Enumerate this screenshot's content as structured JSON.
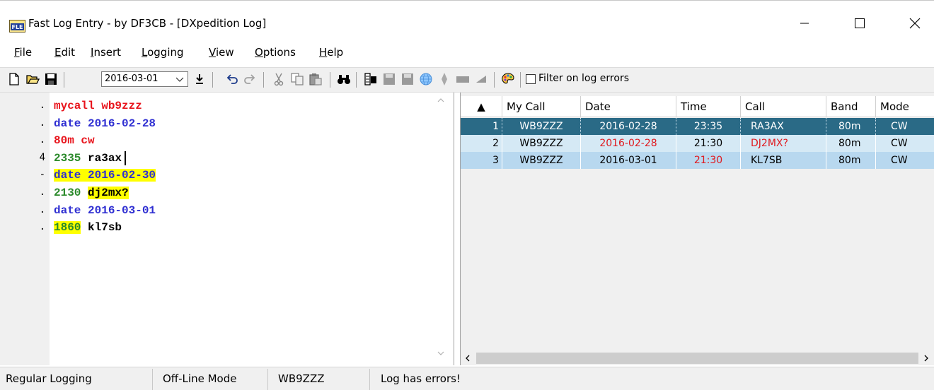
{
  "window": {
    "title": "Fast Log Entry - by DF3CB - [DXpedition Log]",
    "app_icon_text": "FLE",
    "controls": [
      "minimize-icon",
      "maximize-icon",
      "close-icon"
    ]
  },
  "menu": {
    "items": [
      {
        "label": "File",
        "hotkey": "F",
        "rest": "ile"
      },
      {
        "label": "Edit",
        "hotkey": "E",
        "rest": "dit"
      },
      {
        "label": "Insert",
        "hotkey": "I",
        "rest": "nsert"
      },
      {
        "label": "Logging",
        "hotkey": "L",
        "rest": "ogging"
      },
      {
        "label": "View",
        "hotkey": "V",
        "rest": "iew"
      },
      {
        "label": "Options",
        "hotkey": "O",
        "rest": "ptions"
      },
      {
        "label": "Help",
        "hotkey": "H",
        "rest": "elp"
      }
    ]
  },
  "toolbar": {
    "date_value": "2016-03-01",
    "filter_label": "Filter on log errors",
    "filter_checked": false,
    "icons": [
      "new-icon",
      "open-icon",
      "save-icon",
      "download-icon",
      "undo-icon",
      "redo-icon",
      "cut-icon",
      "copy-icon",
      "paste-icon",
      "find-icon",
      "export-icon",
      "upload-icon",
      "upload2-icon",
      "globe-icon",
      "diamond-icon",
      "bar-icon",
      "palette-icon"
    ]
  },
  "editor": {
    "lines": [
      {
        "mark": ".",
        "segments": [
          {
            "t": "mycall wb9zzz",
            "c": "red"
          }
        ]
      },
      {
        "mark": ".",
        "segments": [
          {
            "t": "date 2016-02-28",
            "c": "blue"
          }
        ]
      },
      {
        "mark": ".",
        "segments": [
          {
            "t": "80m cw",
            "c": "red"
          }
        ]
      },
      {
        "mark": "4",
        "segments": [
          {
            "t": "2335",
            "c": "green"
          },
          {
            "t": " ra3ax",
            "c": "black"
          }
        ],
        "caret": true
      },
      {
        "mark": "-",
        "segments": [
          {
            "t": "date 2016-02-30",
            "c": "blue",
            "hl": true
          }
        ]
      },
      {
        "mark": ".",
        "segments": [
          {
            "t": "2130",
            "c": "green"
          },
          {
            "t": " "
          },
          {
            "t": "dj2mx?",
            "c": "black",
            "hl": true
          }
        ]
      },
      {
        "mark": ".",
        "segments": [
          {
            "t": "date 2016-03-01",
            "c": "blue"
          }
        ]
      },
      {
        "mark": ".",
        "segments": [
          {
            "t": "1860",
            "c": "green",
            "hl": true
          },
          {
            "t": " kl7sb",
            "c": "black"
          }
        ]
      }
    ]
  },
  "grid": {
    "headers": [
      "▲",
      "My Call",
      "Date",
      "Time",
      "Call",
      "Band",
      "Mode"
    ],
    "rows": [
      {
        "num": "1",
        "mycall": "WB9ZZZ",
        "date": "2016-02-28",
        "time": "23:35",
        "call": "RA3AX",
        "band": "80m",
        "mode": "CW",
        "selected": true
      },
      {
        "num": "2",
        "mycall": "WB9ZZZ",
        "date": "2016-02-28",
        "time": "21:30",
        "call": "DJ2MX?",
        "band": "80m",
        "mode": "CW",
        "date_err": true,
        "call_err": true
      },
      {
        "num": "3",
        "mycall": "WB9ZZZ",
        "date": "2016-03-01",
        "time": "21:30",
        "call": "KL7SB",
        "band": "80m",
        "mode": "CW",
        "time_err": true
      }
    ]
  },
  "status": {
    "mode": "Regular Logging",
    "connection": "Off-Line Mode",
    "callsign": "WB9ZZZ",
    "message": "Log has errors!"
  }
}
